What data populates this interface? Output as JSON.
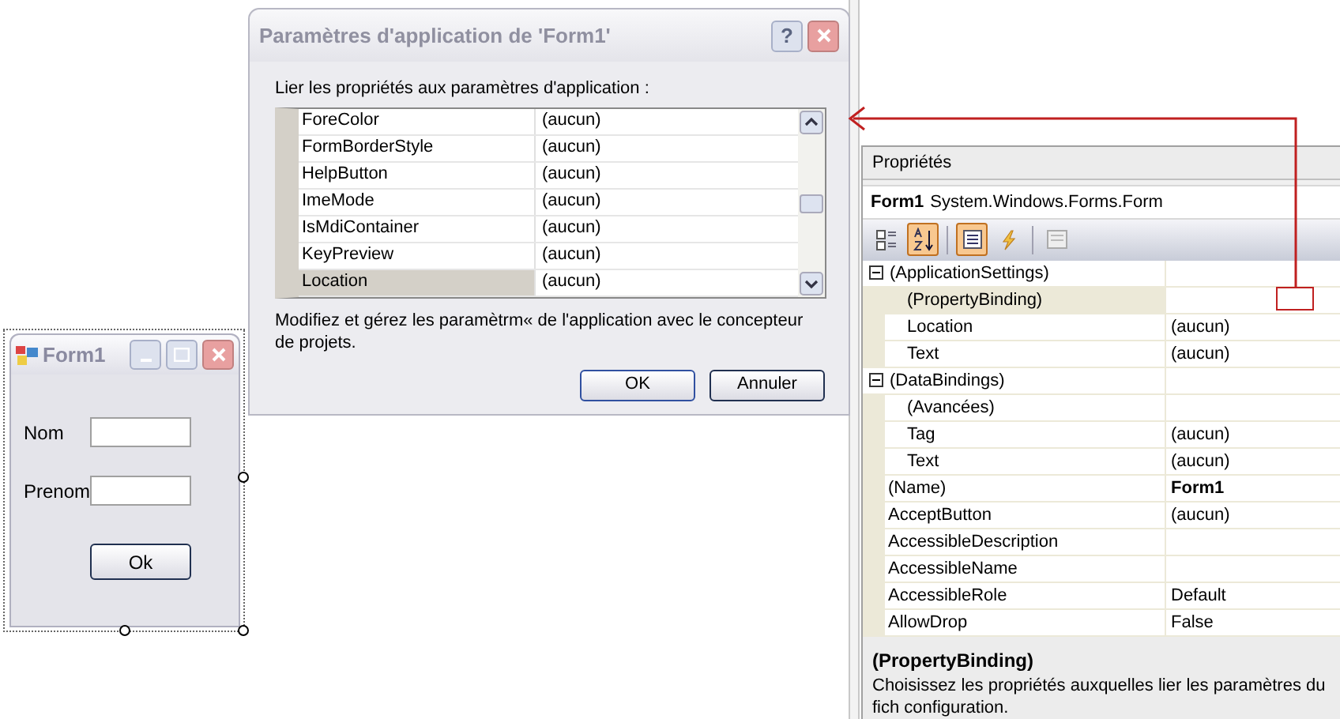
{
  "dialog": {
    "title": "Paramètres d'application de 'Form1'",
    "help_button": "?",
    "prompt": "Lier les propriétés aux paramètres d'application :",
    "rows": [
      {
        "name": "ForeColor",
        "value": "(aucun)",
        "selected": false
      },
      {
        "name": "FormBorderStyle",
        "value": "(aucun)",
        "selected": false
      },
      {
        "name": "HelpButton",
        "value": "(aucun)",
        "selected": false
      },
      {
        "name": "ImeMode",
        "value": "(aucun)",
        "selected": false
      },
      {
        "name": "IsMdiContainer",
        "value": "(aucun)",
        "selected": false
      },
      {
        "name": "KeyPreview",
        "value": "(aucun)",
        "selected": false
      },
      {
        "name": "Location",
        "value": "(aucun)",
        "selected": true
      }
    ],
    "description": "Modifiez et gérez les paramètrm« de l'application avec le concepteur de projets.",
    "buttons": [
      "OK",
      "Annuler"
    ]
  },
  "form": {
    "title": "Form1",
    "fields": [
      {
        "label": "Nom"
      },
      {
        "label": "Prenom"
      }
    ],
    "button": "Ok"
  },
  "properties": {
    "title": "Propriétés",
    "object_name": "Form1",
    "object_type": "System.Windows.Forms.Form",
    "toolbar": [
      {
        "kind": "categorized",
        "selected": false
      },
      {
        "kind": "alphabetical",
        "selected": true
      },
      {
        "kind": "properties",
        "selected": true
      },
      {
        "kind": "events",
        "selected": false
      },
      {
        "kind": "pages",
        "selected": false
      }
    ],
    "rows": [
      {
        "kind": "category",
        "name": "(ApplicationSettings)",
        "expanded": true,
        "children": [
          {
            "name": "(PropertyBinding)",
            "selected": true
          },
          {
            "name": "Location",
            "value": "(aucun)",
            "selected": false
          },
          {
            "name": "Text",
            "value": "(aucun)",
            "selected": false
          }
        ]
      },
      {
        "kind": "category",
        "name": "(DataBindings)",
        "expanded": true,
        "children": [
          {
            "name": "(Avancées)",
            "selected": false
          },
          {
            "name": "Tag",
            "value": "(aucun)",
            "selected": false
          },
          {
            "name": "Text",
            "value": "(aucun)",
            "selected": false
          }
        ]
      },
      {
        "kind": "property",
        "name": "(Name)",
        "value": "Form1",
        "selected": false,
        "bold": true
      },
      {
        "kind": "property",
        "name": "AcceptButton",
        "value": "(aucun)",
        "selected": false
      },
      {
        "kind": "property",
        "name": "AccessibleDescription",
        "selected": false
      },
      {
        "kind": "property",
        "name": "AccessibleName",
        "selected": false
      },
      {
        "kind": "property",
        "name": "AccessibleRole",
        "value": "Default",
        "selected": false
      },
      {
        "kind": "property",
        "name": "AllowDrop",
        "value": "False",
        "selected": false
      }
    ],
    "help_title": "(PropertyBinding)",
    "help_text": "Choisissez les propriétés auxquelles lier les paramètres du fich configuration."
  }
}
